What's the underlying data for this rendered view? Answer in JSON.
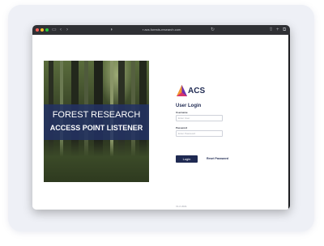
{
  "browser": {
    "address": "acs.forests-research.com",
    "icons": [
      "sidebar-icon",
      "back-icon",
      "forward-icon",
      "shield-icon",
      "reload-icon",
      "share-icon",
      "new-tab-icon",
      "tabs-icon"
    ]
  },
  "hero": {
    "title_line1": "FOREST RESEARCH",
    "title_line2": "ACCESS POINT LISTENER"
  },
  "brand": {
    "name": "ACS",
    "colors": {
      "navy": "#1f2a52",
      "orange": "#f39a2a",
      "magenta": "#d6336c",
      "purple": "#6b2fb3",
      "banner": "#233264"
    }
  },
  "login": {
    "title": "User Login",
    "username_label": "Username",
    "username_placeholder": "Enter User",
    "password_label": "Password",
    "password_placeholder": "Enter Password",
    "login_button": "Login",
    "reset_link": "Reset Password"
  },
  "footer": {
    "version": "V1.0 2021"
  }
}
